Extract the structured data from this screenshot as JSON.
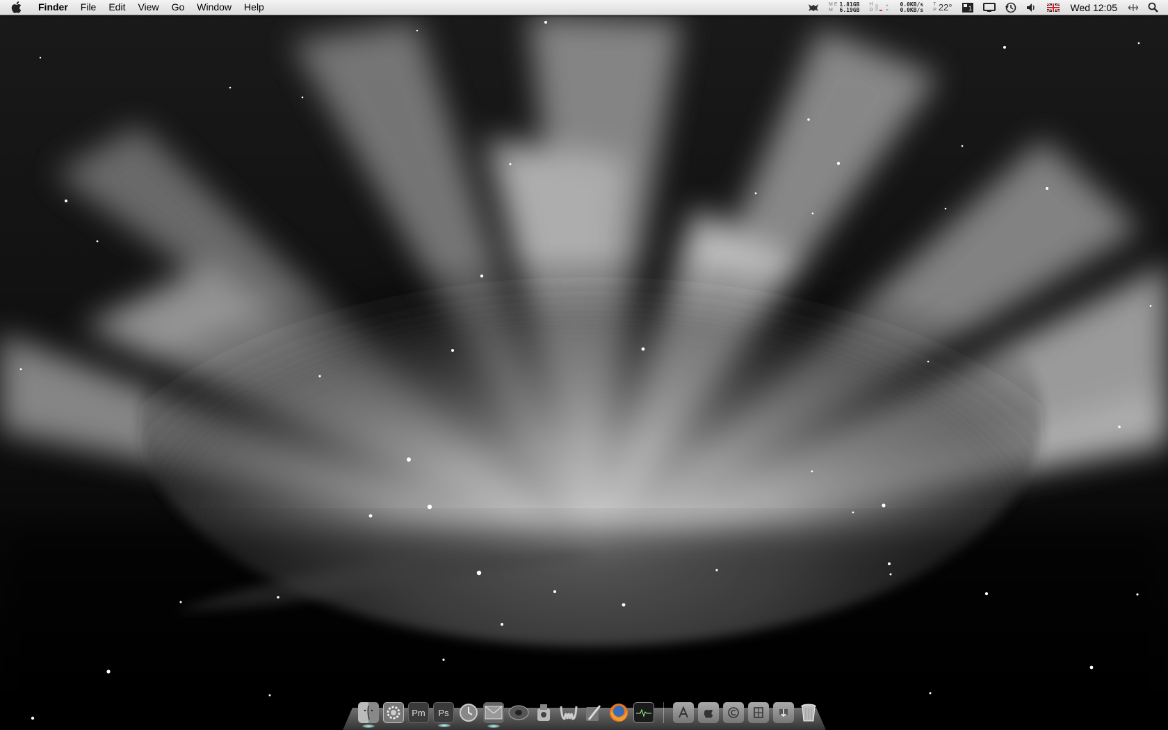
{
  "menubar": {
    "apple_icon": "apple-logo-icon",
    "app_name": "Finder",
    "menus": [
      "File",
      "Edit",
      "View",
      "Go",
      "Window",
      "Help"
    ],
    "status": {
      "memory_used": "1.81GB",
      "memory_free": "6.19GB",
      "mem_label_top": "M E",
      "mem_label_bottom": "M",
      "disk_label_top": "H",
      "disk_label_bottom": "D",
      "net_up": "0.0KB/s",
      "net_down": "0.0KB/s",
      "temp_label_top": "T",
      "temp_label_bottom": "P",
      "temperature": "22°",
      "clock": "Wed 12:05"
    },
    "status_icons": [
      "growl-icon",
      "spaces-icon",
      "display-icon",
      "time-machine-icon",
      "volume-icon",
      "uk-flag-icon",
      "resize-icon",
      "spotlight-icon"
    ]
  },
  "dock": {
    "apps": [
      {
        "name": "Finder",
        "icon": "finder-icon",
        "running": true
      },
      {
        "name": "System Preferences",
        "icon": "system-preferences-icon",
        "running": false
      },
      {
        "name": "Pm",
        "icon": "pagemaker-icon",
        "running": false
      },
      {
        "name": "Ps",
        "icon": "photoshop-icon",
        "running": true
      },
      {
        "name": "Clock",
        "icon": "clock-icon",
        "running": false
      },
      {
        "name": "Mail",
        "icon": "mail-icon",
        "running": true
      },
      {
        "name": "iTunes",
        "icon": "itunes-icon",
        "running": false
      },
      {
        "name": "Utility",
        "icon": "utility-icon",
        "running": false
      },
      {
        "name": "Wacom",
        "icon": "wacom-icon",
        "running": false
      },
      {
        "name": "Editor",
        "icon": "pen-tool-icon",
        "running": false
      },
      {
        "name": "Firefox",
        "icon": "firefox-icon",
        "running": false
      },
      {
        "name": "Activity Monitor",
        "icon": "activity-monitor-icon",
        "running": false
      }
    ],
    "app_labels": {
      "pm": "Pm",
      "ps": "Ps"
    },
    "folders": [
      {
        "icon": "applications-folder-icon"
      },
      {
        "icon": "apple-folder-icon"
      },
      {
        "icon": "copyright-folder-icon"
      },
      {
        "icon": "documents-folder-icon"
      },
      {
        "icon": "downloads-folder-icon"
      }
    ],
    "trash_icon": "trash-icon"
  },
  "colors": {
    "menubar_bg": "#e6e6e6",
    "wallpaper": "#000000",
    "aurora": "#cfcfcf"
  }
}
